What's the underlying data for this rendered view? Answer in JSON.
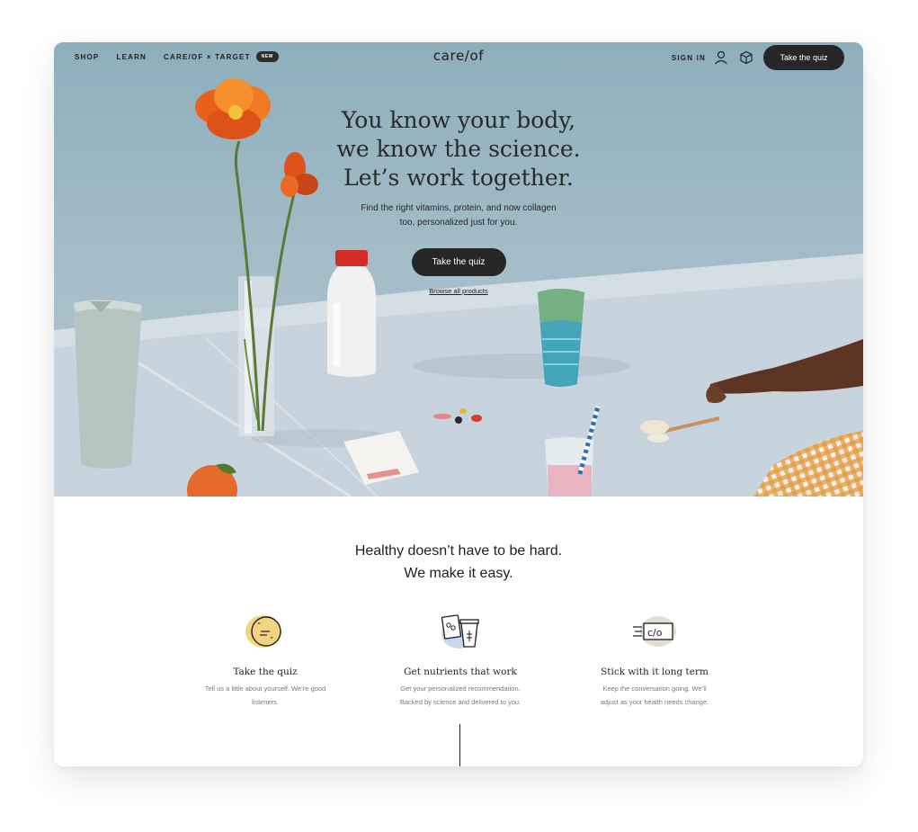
{
  "nav": {
    "shop": "SHOP",
    "learn": "LEARN",
    "careof_target": "CARE/OF × TARGET",
    "new_badge": "NEW",
    "logo": "care/of",
    "sign_in": "SIGN IN",
    "quiz_button": "Take the quiz"
  },
  "hero": {
    "headline": [
      "You know your body,",
      "we know the science.",
      "Let’s work together."
    ],
    "subcopy": [
      "Find the right vitamins, protein, and now collagen",
      "too, personalized just for you."
    ],
    "quiz_button": "Take the quiz",
    "browse_link": "Browse all products"
  },
  "section": {
    "title": [
      "Healthy doesn’t have to be hard.",
      "We make it easy."
    ],
    "features": [
      {
        "icon": "quiz-bubble-icon",
        "title": "Take the quiz",
        "desc": [
          "Tell us a little about yourself. We’re good",
          "listeners."
        ]
      },
      {
        "icon": "nutrients-pack-icon",
        "title": "Get nutrients that work",
        "desc": [
          "Get your personalized recommendation.",
          "Backed by science and delivered to you."
        ]
      },
      {
        "icon": "careof-delivery-box-icon",
        "title": "Stick with it long term",
        "desc": [
          "Keep the conversation going. We’ll",
          "adjust as your health needs change."
        ]
      }
    ]
  },
  "colors": {
    "hero_bg": "#8daebb",
    "button_dark": "#262626",
    "accent_yellow": "#f4d483",
    "accent_blue": "#c9d7ea",
    "accent_gray": "#e3ddd6"
  }
}
